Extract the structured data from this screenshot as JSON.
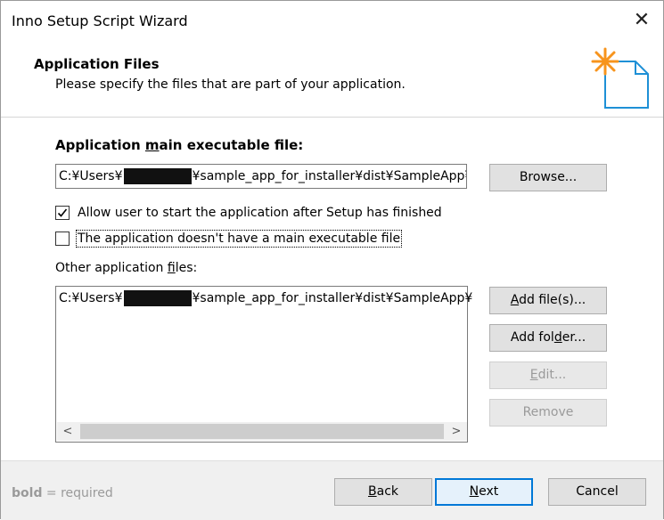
{
  "window": {
    "title": "Inno Setup Script Wizard",
    "close_glyph": "✕"
  },
  "header": {
    "title": "Application Files",
    "subtitle": "Please specify the files that are part of your application."
  },
  "main_exe": {
    "label_pre": "Application ",
    "label_underline": "m",
    "label_post": "ain executable file:",
    "path_prefix": "C:¥Users¥",
    "path_suffix": "¥sample_app_for_installer¥dist¥SampleApp¥",
    "browse_label": "Browse..."
  },
  "options": {
    "allow_start": {
      "checked": true,
      "label": "Allow user to start the application after Setup has finished"
    },
    "no_main_exe": {
      "checked": false,
      "label": "The application doesn't have a main executable file"
    }
  },
  "other_files": {
    "label_pre": "Other application ",
    "label_underline": "f",
    "label_post": "iles:",
    "items": [
      {
        "path_prefix": "C:¥Users¥",
        "path_suffix": "¥sample_app_for_installer¥dist¥SampleApp¥"
      }
    ],
    "buttons": {
      "add_files": {
        "u": "A",
        "rest": "dd file(s)..."
      },
      "add_folder": {
        "pre": "Add fol",
        "u": "d",
        "rest": "er..."
      },
      "edit": {
        "u": "E",
        "rest": "dit..."
      },
      "remove": {
        "label": "Remove"
      }
    },
    "scroll": {
      "left": "<",
      "right": ">"
    }
  },
  "footer": {
    "note_bold": "bold",
    "note_rest": " = required",
    "back": {
      "u": "B",
      "rest": "ack"
    },
    "next": {
      "u": "N",
      "rest": "ext"
    },
    "cancel": "Cancel"
  },
  "colors": {
    "accent": "#0078d7",
    "icon_star": "#f7941d",
    "icon_doc": "#1e90d6"
  }
}
